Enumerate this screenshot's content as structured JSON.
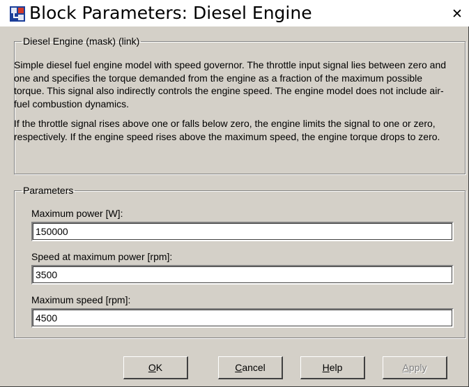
{
  "window": {
    "title": "Block Parameters: Diesel Engine",
    "close_symbol": "✕",
    "icon": "simulink-block-icon"
  },
  "description": {
    "group_label": "Diesel Engine (mask) (link)",
    "paragraph1": "Simple diesel fuel engine model with speed governor.  The throttle input signal lies between zero and one and specifies the torque demanded from the engine as a fraction of the maximum possible torque.  This signal also indirectly controls the engine speed.  The engine model does not include air-fuel combustion dynamics.",
    "paragraph2": "If the throttle signal rises above one or falls below zero, the engine limits the signal to one or zero, respectively. If the engine speed rises above the maximum speed, the engine torque drops to zero."
  },
  "parameters": {
    "group_label": "Parameters",
    "fields": [
      {
        "label": "Maximum power [W]:",
        "value": "150000"
      },
      {
        "label": "Speed at maximum power [rpm]:",
        "value": "3500"
      },
      {
        "label": "Maximum speed [rpm]:",
        "value": "4500"
      }
    ]
  },
  "buttons": {
    "ok": {
      "mnemonic": "O",
      "rest": "K"
    },
    "cancel": {
      "mnemonic": "C",
      "rest": "ancel"
    },
    "help": {
      "mnemonic": "H",
      "rest": "elp"
    },
    "apply": {
      "mnemonic": "A",
      "rest": "pply",
      "enabled": false
    }
  }
}
